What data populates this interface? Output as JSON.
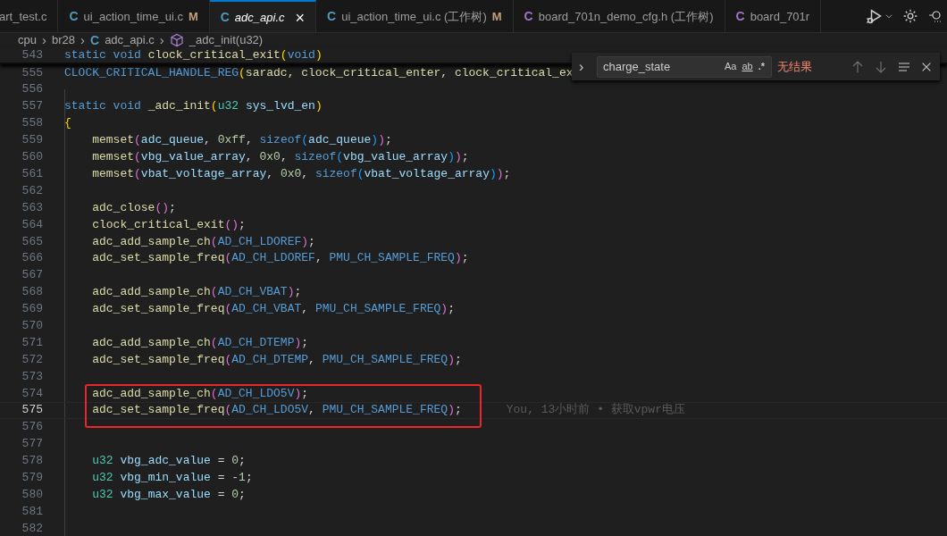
{
  "tabs": [
    {
      "label": "art_test.c",
      "selected": false
    },
    {
      "icon": "C",
      "color": "#519aba",
      "label": "ui_action_time_ui.c",
      "badge": "M",
      "selected": false
    },
    {
      "icon": "C",
      "color": "#519aba",
      "label": "adc_api.c",
      "selected": true,
      "close": "×"
    },
    {
      "icon": "C",
      "color": "#519aba",
      "label": "ui_action_time_ui.c (工作树)",
      "badge": "M",
      "selected": false
    },
    {
      "icon": "C",
      "color": "#a074c4",
      "label": "board_701n_demo_cfg.h (工作树)",
      "selected": false
    },
    {
      "icon": "C",
      "color": "#a074c4",
      "label": "board_701r",
      "selected": false
    }
  ],
  "breadcrumb": {
    "items": [
      {
        "kind": "folder",
        "label": "cpu"
      },
      {
        "kind": "folder",
        "label": "br28"
      },
      {
        "kind": "file",
        "icon": "C",
        "label": "adc_api.c"
      },
      {
        "kind": "symbol",
        "label": "_adc_init(u32)"
      }
    ],
    "separator": "›"
  },
  "find_widget": {
    "toggle": "›",
    "value": "charge_state",
    "options": [
      "Aa",
      "ab",
      ".*"
    ],
    "result": "无结果"
  },
  "editor": {
    "lines": [
      {
        "number": "543",
        "sticky": true,
        "current": false,
        "tokens": [
          {
            "text": "static void ",
            "kind": "keyword"
          },
          {
            "text": "clock_critical_exit",
            "kind": "function"
          },
          {
            "text": "(",
            "kind": "bracket1"
          },
          {
            "text": "void",
            "kind": "keyword"
          },
          {
            "text": ")",
            "kind": "bracket1"
          }
        ]
      },
      {
        "number": "555",
        "sticky": false,
        "current": false,
        "tokens": [
          {
            "text": "CLOCK_CRITICAL_HANDLE_REG",
            "kind": "macro"
          },
          {
            "text": "(",
            "kind": "bracket1"
          },
          {
            "text": "saradc, clock_critical_enter, clock_critical_ex",
            "kind": "function"
          }
        ]
      },
      {
        "number": "556",
        "sticky": false,
        "current": false
      },
      {
        "number": "557",
        "sticky": false,
        "current": false,
        "tokens": [
          {
            "text": "static void ",
            "kind": "keyword"
          },
          {
            "text": "_adc_init",
            "kind": "function"
          },
          {
            "text": "(",
            "kind": "bracket1"
          },
          {
            "text": "u32 ",
            "kind": "type"
          },
          {
            "text": "sys_lvd_en",
            "kind": "variable"
          },
          {
            "text": ")",
            "kind": "bracket1"
          }
        ]
      },
      {
        "number": "558",
        "sticky": false,
        "current": false,
        "tokens": [
          {
            "text": "{",
            "kind": "bracket1"
          }
        ]
      },
      {
        "number": "559",
        "sticky": false,
        "current": false,
        "tokens": [
          {
            "text": "    memset",
            "kind": "function"
          },
          {
            "text": "(",
            "kind": "bracket2"
          },
          {
            "text": "adc_queue",
            "kind": "variable"
          },
          {
            "text": ", ",
            "kind": "punct"
          },
          {
            "text": "0xff",
            "kind": "number"
          },
          {
            "text": ", ",
            "kind": "punct"
          },
          {
            "text": "sizeof",
            "kind": "keyword"
          },
          {
            "text": "(",
            "kind": "bracket3"
          },
          {
            "text": "adc_queue",
            "kind": "variable"
          },
          {
            "text": ")",
            "kind": "bracket3"
          },
          {
            "text": ")",
            "kind": "bracket2"
          },
          {
            "text": ";",
            "kind": "punct"
          }
        ]
      },
      {
        "number": "560",
        "sticky": false,
        "current": false,
        "tokens": [
          {
            "text": "    memset",
            "kind": "function"
          },
          {
            "text": "(",
            "kind": "bracket2"
          },
          {
            "text": "vbg_value_array",
            "kind": "variable"
          },
          {
            "text": ", ",
            "kind": "punct"
          },
          {
            "text": "0x0",
            "kind": "number"
          },
          {
            "text": ", ",
            "kind": "punct"
          },
          {
            "text": "sizeof",
            "kind": "keyword"
          },
          {
            "text": "(",
            "kind": "bracket3"
          },
          {
            "text": "vbg_value_array",
            "kind": "variable"
          },
          {
            "text": ")",
            "kind": "bracket3"
          },
          {
            "text": ")",
            "kind": "bracket2"
          },
          {
            "text": ";",
            "kind": "punct"
          }
        ]
      },
      {
        "number": "561",
        "sticky": false,
        "current": false,
        "tokens": [
          {
            "text": "    memset",
            "kind": "function"
          },
          {
            "text": "(",
            "kind": "bracket2"
          },
          {
            "text": "vbat_voltage_array",
            "kind": "variable"
          },
          {
            "text": ", ",
            "kind": "punct"
          },
          {
            "text": "0x0",
            "kind": "number"
          },
          {
            "text": ", ",
            "kind": "punct"
          },
          {
            "text": "sizeof",
            "kind": "keyword"
          },
          {
            "text": "(",
            "kind": "bracket3"
          },
          {
            "text": "vbat_voltage_array",
            "kind": "variable"
          },
          {
            "text": ")",
            "kind": "bracket3"
          },
          {
            "text": ")",
            "kind": "bracket2"
          },
          {
            "text": ";",
            "kind": "punct"
          }
        ]
      },
      {
        "number": "562",
        "sticky": false,
        "current": false
      },
      {
        "number": "563",
        "sticky": false,
        "current": false,
        "tokens": [
          {
            "text": "    adc_close",
            "kind": "function"
          },
          {
            "text": "()",
            "kind": "bracket2"
          },
          {
            "text": ";",
            "kind": "punct"
          }
        ]
      },
      {
        "number": "564",
        "sticky": false,
        "current": false,
        "tokens": [
          {
            "text": "    clock_critical_exit",
            "kind": "function"
          },
          {
            "text": "()",
            "kind": "bracket2"
          },
          {
            "text": ";",
            "kind": "punct"
          }
        ]
      },
      {
        "number": "565",
        "sticky": false,
        "current": false,
        "tokens": [
          {
            "text": "    adc_add_sample_ch",
            "kind": "function"
          },
          {
            "text": "(",
            "kind": "bracket2"
          },
          {
            "text": "AD_CH_LDOREF",
            "kind": "macro"
          },
          {
            "text": ")",
            "kind": "bracket2"
          },
          {
            "text": ";",
            "kind": "punct"
          }
        ]
      },
      {
        "number": "566",
        "sticky": false,
        "current": false,
        "tokens": [
          {
            "text": "    adc_set_sample_freq",
            "kind": "function"
          },
          {
            "text": "(",
            "kind": "bracket2"
          },
          {
            "text": "AD_CH_LDOREF",
            "kind": "macro"
          },
          {
            "text": ", ",
            "kind": "punct"
          },
          {
            "text": "PMU_CH_SAMPLE_FREQ",
            "kind": "macro"
          },
          {
            "text": ")",
            "kind": "bracket2"
          },
          {
            "text": ";",
            "kind": "punct"
          }
        ]
      },
      {
        "number": "567",
        "sticky": false,
        "current": false
      },
      {
        "number": "568",
        "sticky": false,
        "current": false,
        "tokens": [
          {
            "text": "    adc_add_sample_ch",
            "kind": "function"
          },
          {
            "text": "(",
            "kind": "bracket2"
          },
          {
            "text": "AD_CH_VBAT",
            "kind": "macro"
          },
          {
            "text": ")",
            "kind": "bracket2"
          },
          {
            "text": ";",
            "kind": "punct"
          }
        ]
      },
      {
        "number": "569",
        "sticky": false,
        "current": false,
        "tokens": [
          {
            "text": "    adc_set_sample_freq",
            "kind": "function"
          },
          {
            "text": "(",
            "kind": "bracket2"
          },
          {
            "text": "AD_CH_VBAT",
            "kind": "macro"
          },
          {
            "text": ", ",
            "kind": "punct"
          },
          {
            "text": "PMU_CH_SAMPLE_FREQ",
            "kind": "macro"
          },
          {
            "text": ")",
            "kind": "bracket2"
          },
          {
            "text": ";",
            "kind": "punct"
          }
        ]
      },
      {
        "number": "570",
        "sticky": false,
        "current": false
      },
      {
        "number": "571",
        "sticky": false,
        "current": false,
        "tokens": [
          {
            "text": "    adc_add_sample_ch",
            "kind": "function"
          },
          {
            "text": "(",
            "kind": "bracket2"
          },
          {
            "text": "AD_CH_DTEMP",
            "kind": "macro"
          },
          {
            "text": ")",
            "kind": "bracket2"
          },
          {
            "text": ";",
            "kind": "punct"
          }
        ]
      },
      {
        "number": "572",
        "sticky": false,
        "current": false,
        "tokens": [
          {
            "text": "    adc_set_sample_freq",
            "kind": "function"
          },
          {
            "text": "(",
            "kind": "bracket2"
          },
          {
            "text": "AD_CH_DTEMP",
            "kind": "macro"
          },
          {
            "text": ", ",
            "kind": "punct"
          },
          {
            "text": "PMU_CH_SAMPLE_FREQ",
            "kind": "macro"
          },
          {
            "text": ")",
            "kind": "bracket2"
          },
          {
            "text": ";",
            "kind": "punct"
          }
        ]
      },
      {
        "number": "573",
        "sticky": false,
        "current": false
      },
      {
        "number": "574",
        "sticky": false,
        "current": false,
        "tokens": [
          {
            "text": "    adc_add_sample_ch",
            "kind": "function"
          },
          {
            "text": "(",
            "kind": "bracket2"
          },
          {
            "text": "AD_CH_LDO5V",
            "kind": "macro"
          },
          {
            "text": ")",
            "kind": "bracket2"
          },
          {
            "text": ";",
            "kind": "punct"
          }
        ]
      },
      {
        "number": "575",
        "sticky": false,
        "current": true,
        "blame": "You, 13小时前 • 获取vpwr电压",
        "tokens": [
          {
            "text": "    adc_set_sample_freq",
            "kind": "function"
          },
          {
            "text": "(",
            "kind": "bracket2"
          },
          {
            "text": "AD_CH_LDO5V",
            "kind": "macro"
          },
          {
            "text": ", ",
            "kind": "punct"
          },
          {
            "text": "PMU_CH_SAMPLE_FREQ",
            "kind": "macro"
          },
          {
            "text": ")",
            "kind": "bracket2"
          },
          {
            "text": ";",
            "kind": "punct"
          }
        ]
      },
      {
        "number": "576",
        "sticky": false,
        "current": false
      },
      {
        "number": "577",
        "sticky": false,
        "current": false
      },
      {
        "number": "578",
        "sticky": false,
        "current": false,
        "tokens": [
          {
            "text": "    u32 ",
            "kind": "type"
          },
          {
            "text": "vbg_adc_value",
            "kind": "variable"
          },
          {
            "text": " = ",
            "kind": "punct"
          },
          {
            "text": "0",
            "kind": "number"
          },
          {
            "text": ";",
            "kind": "punct"
          }
        ]
      },
      {
        "number": "579",
        "sticky": false,
        "current": false,
        "tokens": [
          {
            "text": "    u32 ",
            "kind": "type"
          },
          {
            "text": "vbg_min_value",
            "kind": "variable"
          },
          {
            "text": " = -",
            "kind": "punct"
          },
          {
            "text": "1",
            "kind": "number"
          },
          {
            "text": ";",
            "kind": "punct"
          }
        ]
      },
      {
        "number": "580",
        "sticky": false,
        "current": false,
        "tokens": [
          {
            "text": "    u32 ",
            "kind": "type"
          },
          {
            "text": "vbg_max_value",
            "kind": "variable"
          },
          {
            "text": " = ",
            "kind": "punct"
          },
          {
            "text": "0",
            "kind": "number"
          },
          {
            "text": ";",
            "kind": "punct"
          }
        ]
      },
      {
        "number": "581",
        "sticky": false,
        "current": false
      },
      {
        "number": "582",
        "sticky": false,
        "current": false
      }
    ]
  }
}
